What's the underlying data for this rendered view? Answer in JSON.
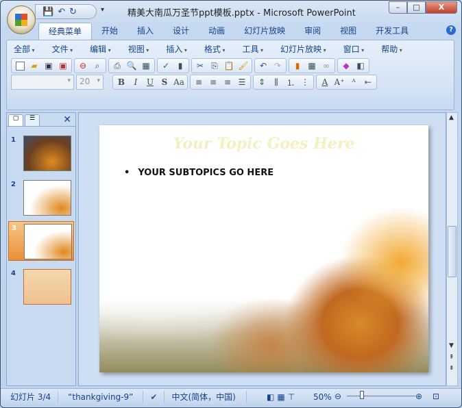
{
  "window": {
    "title": "精美大南瓜万圣节ppt模板.pptx - Microsoft PowerPoint",
    "minimize": "–",
    "maximize": "□",
    "close": "X"
  },
  "qat": {
    "save": "💾",
    "undo": "↶",
    "redo": "↻",
    "more": "▾"
  },
  "tabs": [
    "经典菜单",
    "开始",
    "插入",
    "设计",
    "动画",
    "幻灯片放映",
    "审阅",
    "视图",
    "开发工具"
  ],
  "help": "?",
  "menus": [
    "全部",
    "文件",
    "编辑",
    "视图",
    "插入",
    "格式",
    "工具",
    "幻灯片放映",
    "窗口",
    "帮助"
  ],
  "format": {
    "font": "",
    "size": "20",
    "bold": "B",
    "italic": "I",
    "underline": "U",
    "shadow": "S",
    "case": "Aa",
    "font_color": "A"
  },
  "pane": {
    "close": "✕",
    "thumbs": [
      "1",
      "2",
      "3",
      "4"
    ]
  },
  "slide": {
    "title": "Your Topic Goes Here",
    "bullet_mark": "•",
    "bullet": "YOUR SUBTOPICS GO HERE"
  },
  "status": {
    "slide": "幻灯片 3/4",
    "theme": "“thankgiving-9”",
    "language": "中文(简体，中国)",
    "zoom": "50%",
    "zoom_value": 50
  }
}
